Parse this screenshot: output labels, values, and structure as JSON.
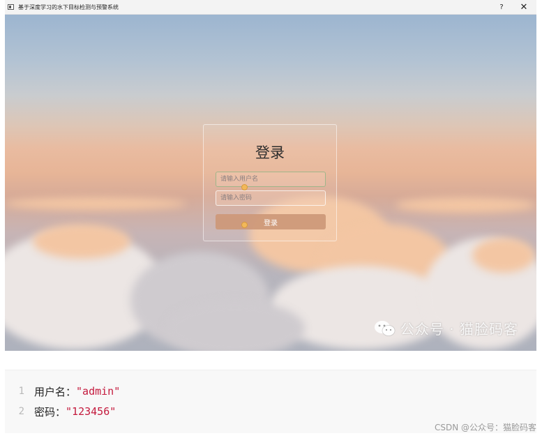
{
  "window": {
    "title": "基于深度学习的水下目标检测与预警系统",
    "help_label": "?",
    "close_label": "✕"
  },
  "login": {
    "title": "登录",
    "username_placeholder": "请输入用户名",
    "password_placeholder": "请输入密码",
    "button_label": "登录"
  },
  "watermark": {
    "text": "公众号 · 猫脸码客"
  },
  "code": {
    "lines": [
      {
        "number": "1",
        "key": "用户名：",
        "value": "\"admin\""
      },
      {
        "number": "2",
        "key": "密码：",
        "value": "\"123456\""
      }
    ]
  },
  "footer": {
    "credit": "CSDN @公众号：猫脸码客"
  },
  "colors": {
    "accent_button": "#cd9878",
    "code_string": "#c41a3d",
    "field_focus_border": "#9fb68a"
  }
}
